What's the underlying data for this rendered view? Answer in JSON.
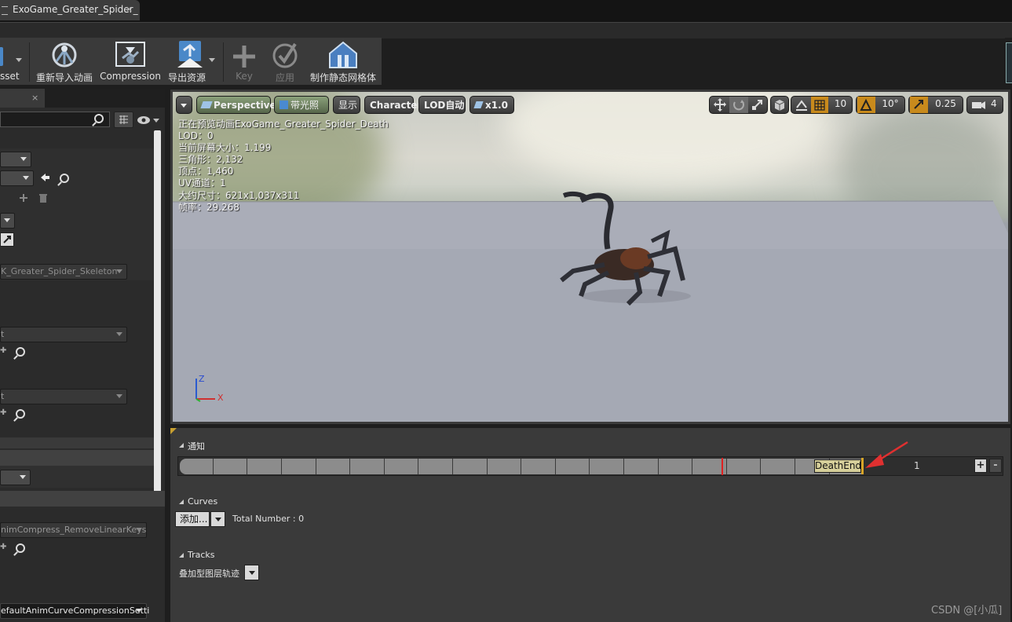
{
  "window": {
    "tab_title": "ExoGame_Greater_Spider_",
    "tab_close": "×"
  },
  "toolbar": {
    "asset_label": "sset",
    "reimport_label": "重新导入动画",
    "compression_label": "Compression",
    "export_label": "导出资源",
    "key_label": "Key",
    "apply_label": "应用",
    "make_static_mesh_label": "制作静态网格体"
  },
  "left_panel": {
    "tab_close": "×",
    "skeleton_value": "K_Greater_Spider_Skeleton",
    "combo_b_value": "t",
    "combo_c_value": "t",
    "compression_value": "nimCompress_RemoveLinearKeys",
    "curve_compression_value": "efaultAnimCurveCompressionSetti"
  },
  "viewport": {
    "perspective_label": "Perspective",
    "lit_label": "带光照",
    "show_label": "显示",
    "character_label": "Character",
    "lod_label": "LOD自动",
    "speed_label": "x1.0",
    "grid_snap_value": "10",
    "rotate_snap_value": "10°",
    "scale_snap_value": "0.25",
    "camera_speed_value": "4",
    "stats": [
      "正在预览动画ExoGame_Greater_Spider_Death",
      "LOD：0",
      "当前屏幕大小：1.199",
      "三角形：2,132",
      "顶点：1,460",
      "UV通道：1",
      "大约尺寸：621x1,037x311",
      "帧率：29.268"
    ],
    "axis_z": "Z",
    "axis_x": "X"
  },
  "timeline": {
    "notifies_label": "通知",
    "notify_name": "DeathEnd",
    "track_number": "1",
    "plus_label": "+",
    "minus_label": "-",
    "curves_label": "Curves",
    "add_button_label": "添加...",
    "total_number_text": "Total Number : 0",
    "tracks_label": "Tracks",
    "additive_layer_tracks_label": "叠加型图层轨迹"
  },
  "watermark": "CSDN @[小瓜]",
  "colors": {
    "panel_bg": "#3a3a3a",
    "notify_fill": "#d6cf9a",
    "notify_marker": "#d8a528",
    "playhead": "#e02020",
    "arrow": "#e03030",
    "snap_active": "#c88a1c"
  }
}
